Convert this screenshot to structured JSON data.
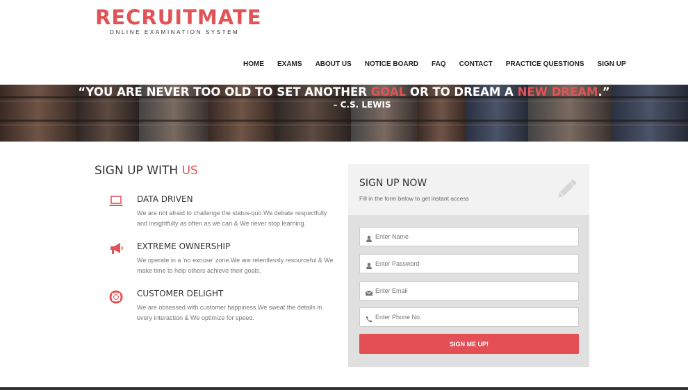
{
  "brand": {
    "title": "RECRUITMATE",
    "subtitle": "ONLINE EXAMINATION SYSTEM",
    "color": "#e05458"
  },
  "nav": {
    "items": [
      "HOME",
      "EXAMS",
      "ABOUT US",
      "NOTICE BOARD",
      "FAQ",
      "CONTACT",
      "PRACTICE QUESTIONS",
      "SIGN UP"
    ]
  },
  "hero": {
    "quote_open": "“YOU ARE NEVER TOO OLD TO SET ANOTHER ",
    "quote_hl1": "GOAL",
    "quote_mid": " OR TO DREAM A ",
    "quote_hl2": "NEW DREAM",
    "quote_close": ".”",
    "author": "– C.S. LEWIS"
  },
  "signup_section": {
    "title_main": "SIGN UP WITH ",
    "title_accent": "US",
    "features": [
      {
        "icon": "laptop-icon",
        "title": "DATA DRIVEN",
        "text": "We are not afraid to challenge the status-quo.We debate respectfully and insightfully as often as we can & We never stop learning."
      },
      {
        "icon": "megaphone-icon",
        "title": "EXTREME OWNERSHIP",
        "text": "We operate in a 'no excuse' zone.We are relentlessly resourceful & We make time to help others achieve their goals."
      },
      {
        "icon": "life-ring-icon",
        "title": "CUSTOMER DELIGHT",
        "text": "We are obsessed with customer happiness.We sweat the details in every interaction & We optimize for speed."
      }
    ]
  },
  "form": {
    "title": "SIGN UP NOW",
    "subtitle": "Fill in the form below to get instant access",
    "name_placeholder": "Enter Name",
    "password_placeholder": "Enter Password",
    "email_placeholder": "Enter Email",
    "phone_placeholder": "Enter Phone No.",
    "submit_label": "SIGN ME UP!"
  },
  "colors": {
    "accent": "#e05458",
    "button": "#e34f54",
    "card_bg": "#e0e0e0",
    "card_head_bg": "#f2f2f2"
  }
}
